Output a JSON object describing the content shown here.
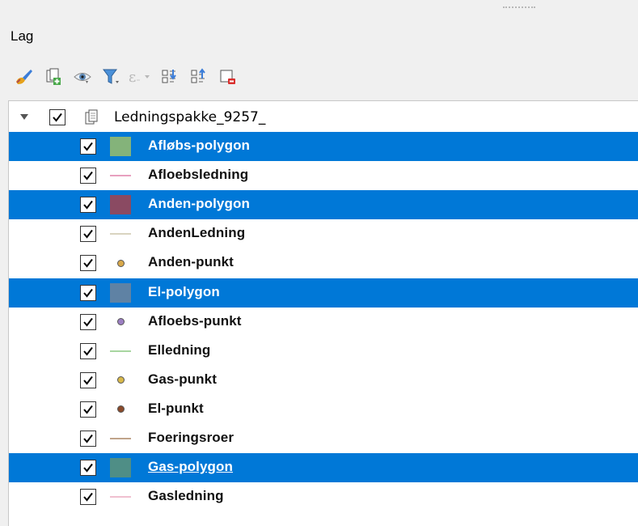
{
  "panel": {
    "title": "Lag"
  },
  "toolbar": {
    "buttons": [
      {
        "name": "style-brush"
      },
      {
        "name": "add-group"
      },
      {
        "name": "manage-visibility"
      },
      {
        "name": "filter-legend"
      },
      {
        "name": "filter-expression"
      },
      {
        "name": "expand-all"
      },
      {
        "name": "collapse-all"
      },
      {
        "name": "remove-layer"
      }
    ]
  },
  "tree": {
    "group": {
      "label": "Ledningspakke_9257_",
      "checked": true,
      "expanded": true
    },
    "layers": [
      {
        "label": "Afløbs-polygon",
        "symbol": "polygon",
        "color": "#84b37a",
        "selected": true
      },
      {
        "label": "Afloebsledning",
        "symbol": "line",
        "color": "#e8a0bf",
        "selected": false
      },
      {
        "label": "Anden-polygon",
        "symbol": "polygon",
        "color": "#8a4a62",
        "selected": true
      },
      {
        "label": "AndenLedning",
        "symbol": "line",
        "color": "#d9d4c0",
        "selected": false
      },
      {
        "label": "Anden-punkt",
        "symbol": "point",
        "color": "#d8a84a",
        "selected": false
      },
      {
        "label": "El-polygon",
        "symbol": "polygon",
        "color": "#5f82a4",
        "selected": true
      },
      {
        "label": "Afloebs-punkt",
        "symbol": "point",
        "color": "#9c7fc2",
        "selected": false
      },
      {
        "label": "Elledning",
        "symbol": "line",
        "color": "#a8d6a0",
        "selected": false
      },
      {
        "label": "Gas-punkt",
        "symbol": "point",
        "color": "#d8b84a",
        "selected": false
      },
      {
        "label": "El-punkt",
        "symbol": "point",
        "color": "#8a4a2a",
        "selected": false
      },
      {
        "label": "Foeringsroer",
        "symbol": "line",
        "color": "#c0a48a",
        "selected": false
      },
      {
        "label": "Gas-polygon",
        "symbol": "polygon",
        "color": "#4f8e86",
        "selected": true,
        "underline": true
      },
      {
        "label": "Gasledning",
        "symbol": "line",
        "color": "#f0c0d0",
        "selected": false
      }
    ]
  },
  "colors": {
    "selection": "#0078d7"
  }
}
